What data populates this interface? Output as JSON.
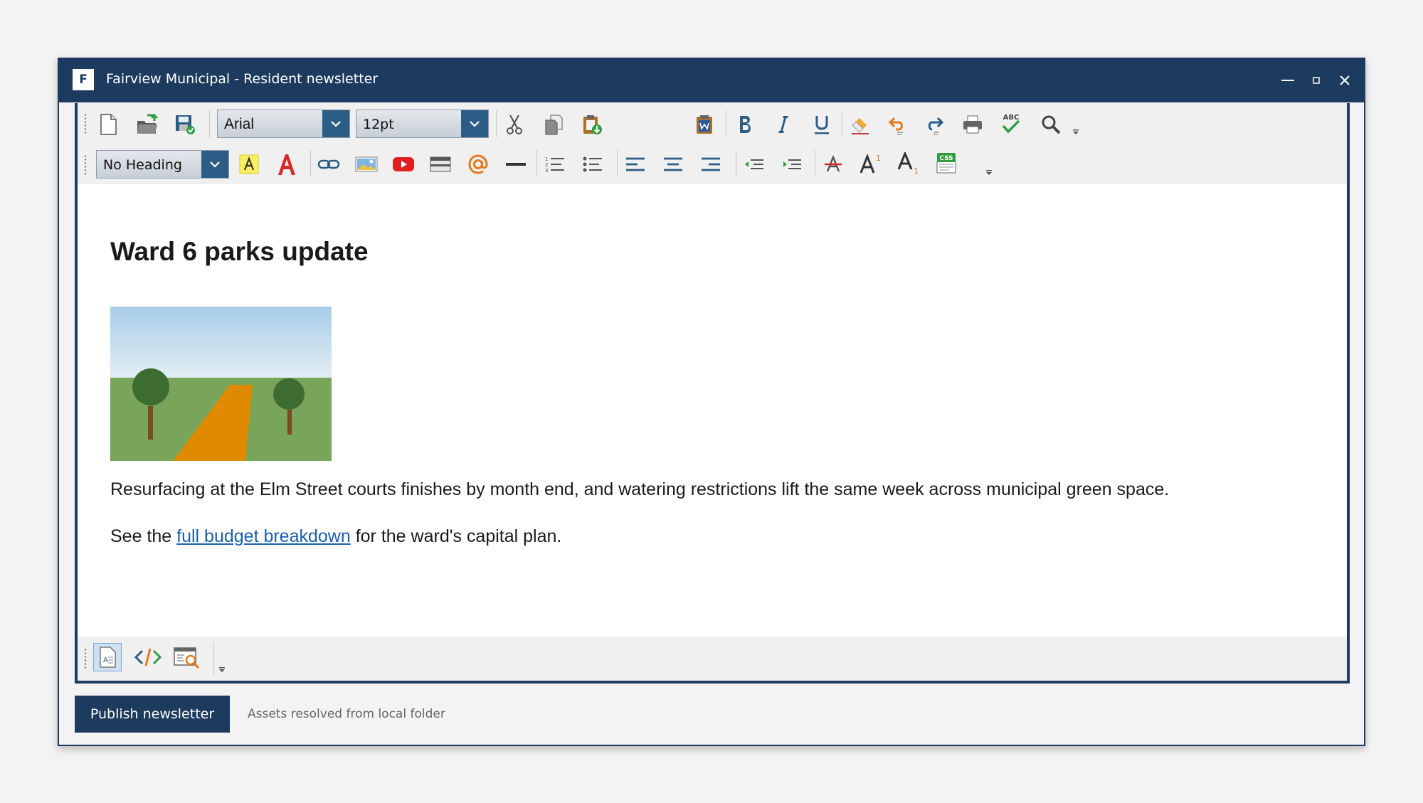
{
  "window": {
    "logo_letter": "F",
    "title": "Fairview Municipal - Resident newsletter"
  },
  "toolbar": {
    "font_family": "Arial",
    "font_size": "12pt",
    "heading_style": "No Heading",
    "superscript_mark": "1",
    "subscript_mark": "1",
    "spell_label": "ABC",
    "css_label": "CSS"
  },
  "document": {
    "heading": "Ward 6 parks update",
    "paragraph_1": "Resurfacing at the Elm Street courts finishes by month end, and watering restrictions lift the same week across municipal green space.",
    "paragraph_2_before": "See the ",
    "paragraph_2_link": "full budget breakdown",
    "paragraph_2_after": " for the ward's capital plan."
  },
  "footer": {
    "publish_label": "Publish newsletter",
    "status": "Assets resolved from local folder"
  },
  "colors": {
    "brand": "#1d3a5f",
    "link": "#1a5fb4"
  }
}
